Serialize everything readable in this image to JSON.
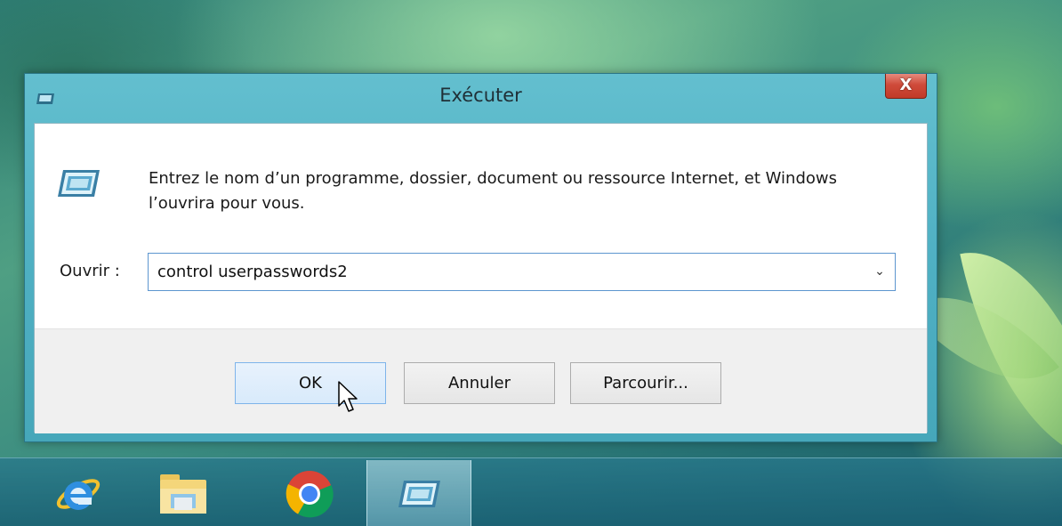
{
  "window": {
    "title": "Exécuter",
    "close_label": "X"
  },
  "dialog": {
    "description": "Entrez le nom d’un programme, dossier, document ou ressource Internet, et Windows l’ouvrira pour vous.",
    "open_label": "Ouvrir :",
    "command_value": "control userpasswords2",
    "dropdown_glyph": "⌄",
    "buttons": {
      "ok": "OK",
      "cancel": "Annuler",
      "browse": "Parcourir..."
    }
  },
  "taskbar": {
    "items": [
      {
        "icon": "internet-explorer-icon"
      },
      {
        "icon": "file-explorer-icon"
      },
      {
        "icon": "chrome-icon"
      },
      {
        "icon": "run-icon",
        "active": true
      }
    ]
  },
  "colors": {
    "window_frame": "#4fb0c3",
    "close_button": "#c13a28",
    "ok_button_border": "#7eb4ea",
    "input_border": "#5d96cf"
  }
}
